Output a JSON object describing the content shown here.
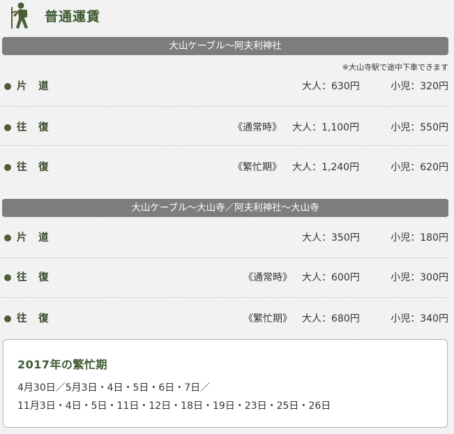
{
  "header": {
    "icon": "hiker-icon",
    "title": "普通運賃"
  },
  "colors": {
    "accent_green": "#3f5a32",
    "bar_gray": "#7d7d7d"
  },
  "section1": {
    "route": "大山ケーブル～阿夫利神社",
    "note": "※大山寺駅で途中下車できます",
    "rows": [
      {
        "label": "片　道",
        "period": "",
        "adult": "大人：630円",
        "child": "小児：320円"
      },
      {
        "label": "往　復",
        "period": "《通常時》",
        "adult": "大人：1,100円",
        "child": "小児：550円"
      },
      {
        "label": "往　復",
        "period": "《繁忙期》",
        "adult": "大人：1,240円",
        "child": "小児：620円"
      }
    ]
  },
  "section2": {
    "route": "大山ケーブル～大山寺／阿夫利神社～大山寺",
    "rows": [
      {
        "label": "片　道",
        "period": "",
        "adult": "大人：350円",
        "child": "小児：180円"
      },
      {
        "label": "往　復",
        "period": "《通常時》",
        "adult": "大人：600円",
        "child": "小児：300円"
      },
      {
        "label": "往　復",
        "period": "《繁忙期》",
        "adult": "大人：680円",
        "child": "小児：340円"
      }
    ]
  },
  "busy": {
    "title": "2017年の繁忙期",
    "line1": "4月30日／5月3日・4日・5日・6日・7日／",
    "line2": "11月3日・4日・5日・11日・12日・18日・19日・23日・25日・26日"
  }
}
